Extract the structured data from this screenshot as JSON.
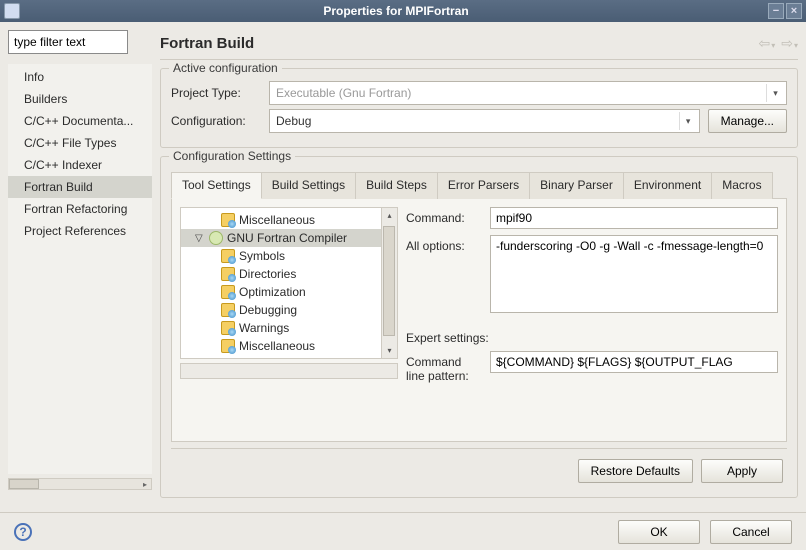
{
  "window": {
    "title": "Properties for MPIFortran",
    "min": "−",
    "close": "×"
  },
  "sidebar": {
    "filter_placeholder": "type filter text",
    "items": [
      {
        "label": "Info"
      },
      {
        "label": "Builders"
      },
      {
        "label": "C/C++ Documenta..."
      },
      {
        "label": "C/C++ File Types"
      },
      {
        "label": "C/C++ Indexer"
      },
      {
        "label": "Fortran Build"
      },
      {
        "label": "Fortran Refactoring"
      },
      {
        "label": "Project References"
      }
    ]
  },
  "heading": "Fortran Build",
  "active_config": {
    "title": "Active configuration",
    "project_type_label": "Project Type:",
    "project_type_value": "Executable (Gnu Fortran)",
    "configuration_label": "Configuration:",
    "configuration_value": "Debug",
    "manage_btn": "Manage..."
  },
  "config_settings": {
    "title": "Configuration Settings",
    "tabs": [
      "Tool Settings",
      "Build Settings",
      "Build Steps",
      "Error Parsers",
      "Binary Parser",
      "Environment",
      "Macros"
    ],
    "tree": [
      {
        "label": "Miscellaneous",
        "indent": true,
        "kind": "leaf"
      },
      {
        "label": "GNU Fortran Compiler",
        "indent": false,
        "kind": "gear",
        "expanded": true,
        "selected": true
      },
      {
        "label": "Symbols",
        "indent": true,
        "kind": "leaf"
      },
      {
        "label": "Directories",
        "indent": true,
        "kind": "leaf"
      },
      {
        "label": "Optimization",
        "indent": true,
        "kind": "leaf"
      },
      {
        "label": "Debugging",
        "indent": true,
        "kind": "leaf"
      },
      {
        "label": "Warnings",
        "indent": true,
        "kind": "leaf"
      },
      {
        "label": "Miscellaneous",
        "indent": true,
        "kind": "leaf"
      }
    ],
    "command_label": "Command:",
    "command_value": "mpif90",
    "all_options_label": "All options:",
    "all_options_value": "-funderscoring -O0 -g -Wall -c -fmessage-length=0",
    "expert_label": "Expert settings:",
    "pattern_label_1": "Command",
    "pattern_label_2": "line pattern:",
    "pattern_value": "${COMMAND} ${FLAGS} ${OUTPUT_FLAG"
  },
  "buttons": {
    "restore": "Restore Defaults",
    "apply": "Apply",
    "ok": "OK",
    "cancel": "Cancel"
  }
}
